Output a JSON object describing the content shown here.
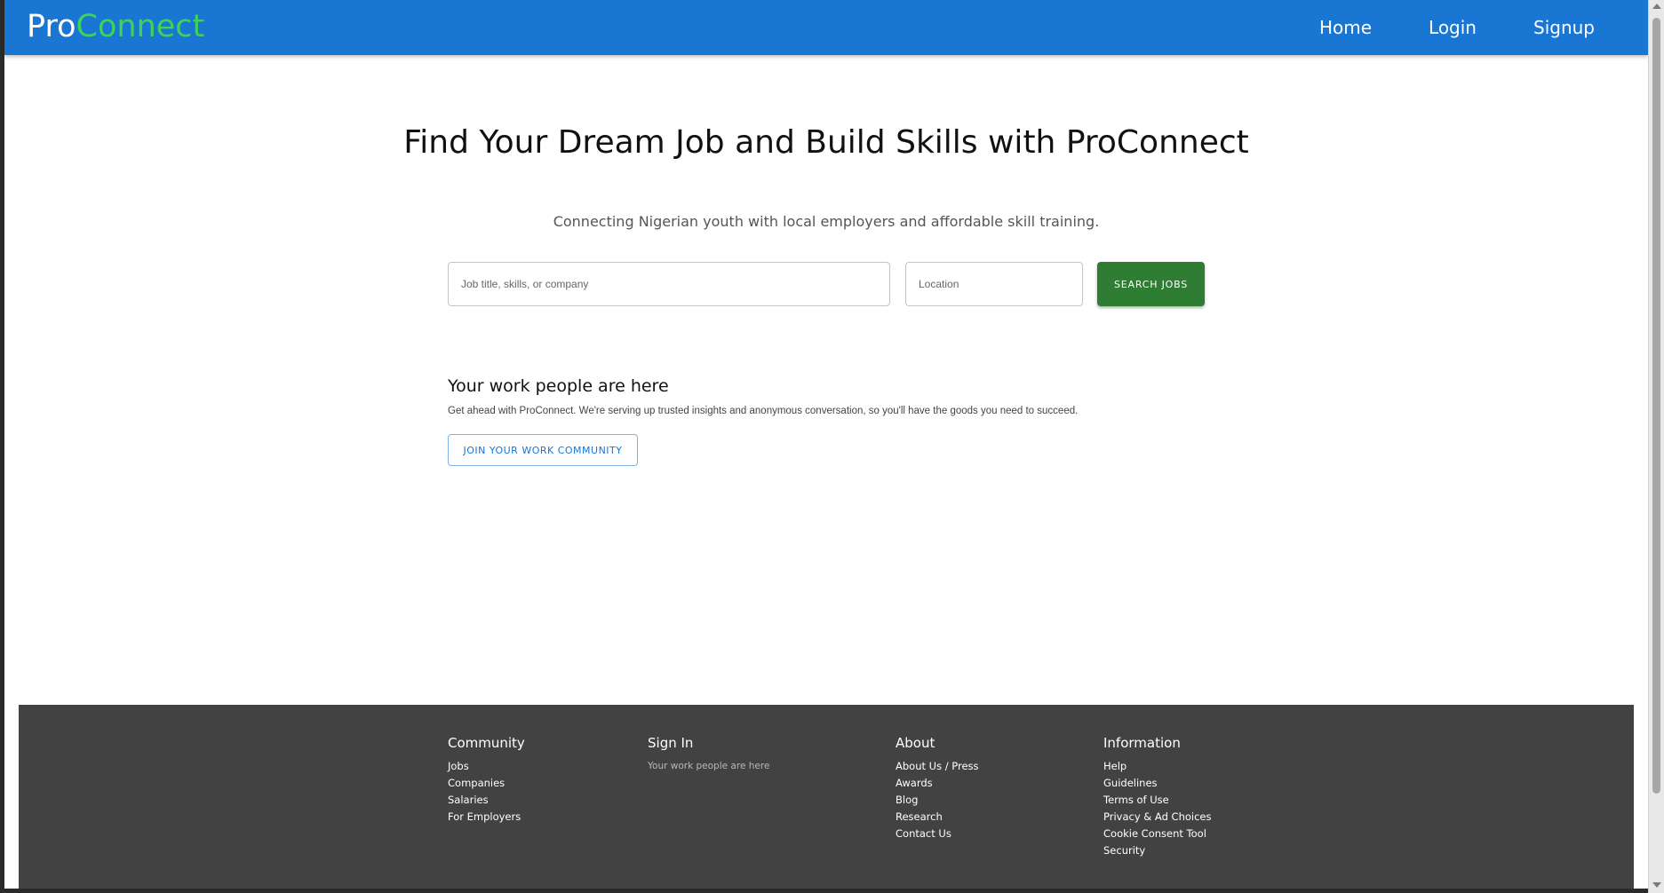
{
  "navbar": {
    "logo_part1": "Pro",
    "logo_part2": "Connect",
    "links": [
      "Home",
      "Login",
      "Signup"
    ]
  },
  "hero": {
    "title": "Find Your Dream Job and Build Skills with ProConnect",
    "subtitle": "Connecting Nigerian youth with local employers and affordable skill training.",
    "search": {
      "job_placeholder": "Job title, skills, or company",
      "location_placeholder": "Location",
      "button_label": "SEARCH JOBS"
    }
  },
  "work_people": {
    "title": "Your work people are here",
    "text": "Get ahead with ProConnect. We're serving up trusted insights and anonymous conversation, so you'll have the goods you need to succeed.",
    "button_label": "JOIN YOUR WORK COMMUNITY"
  },
  "footer": {
    "community": {
      "heading": "Community",
      "items": [
        "Jobs",
        "Companies",
        "Salaries",
        "For Employers"
      ]
    },
    "signin": {
      "heading": "Sign In",
      "text": "Your work people are here"
    },
    "about": {
      "heading": "About",
      "items": [
        "About Us / Press",
        "Awards",
        "Blog",
        "Research",
        "Contact Us"
      ]
    },
    "information": {
      "heading": "Information",
      "items": [
        "Help",
        "Guidelines",
        "Terms of Use",
        "Privacy & Ad Choices",
        "Cookie Consent Tool",
        "Security"
      ]
    }
  },
  "colors": {
    "navbar": "#1976d2",
    "logo_accent": "#3fd25a",
    "search_button": "#2e7d32",
    "footer": "#424242"
  }
}
